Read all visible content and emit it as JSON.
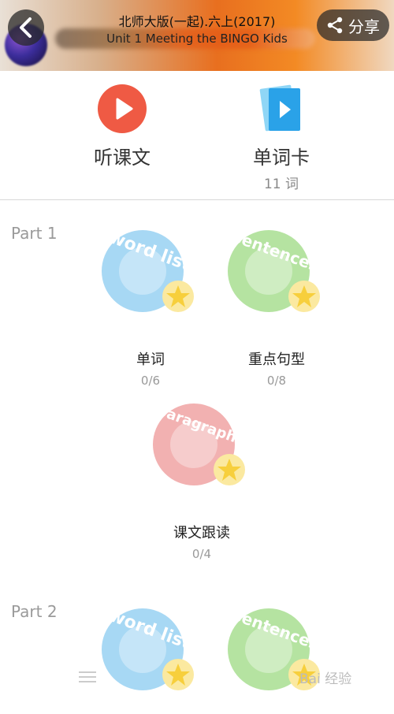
{
  "header": {
    "title_line1": "北师大版(一起).六上(2017)",
    "title_line2": "Unit 1 Meeting the BINGO Kids",
    "share_label": "分享"
  },
  "actions": [
    {
      "label": "听课文",
      "sub": ""
    },
    {
      "label": "单词卡",
      "sub": "11 词"
    }
  ],
  "parts": [
    {
      "title": "Part 1",
      "items": [
        {
          "label": "单词",
          "count": "0/6",
          "badge": "word list",
          "color": "#a7d8f4"
        },
        {
          "label": "重点句型",
          "count": "0/8",
          "badge": "sentences",
          "color": "#b5e3a1"
        },
        {
          "label": "课文跟读",
          "count": "0/4",
          "badge": "paragraphs",
          "color": "#f2b1b1"
        }
      ]
    },
    {
      "title": "Part 2",
      "items": [
        {
          "badge": "word list",
          "color": "#a7d8f4"
        },
        {
          "badge": "sentences",
          "color": "#b5e3a1"
        }
      ]
    }
  ],
  "watermark": "Bai 经验"
}
